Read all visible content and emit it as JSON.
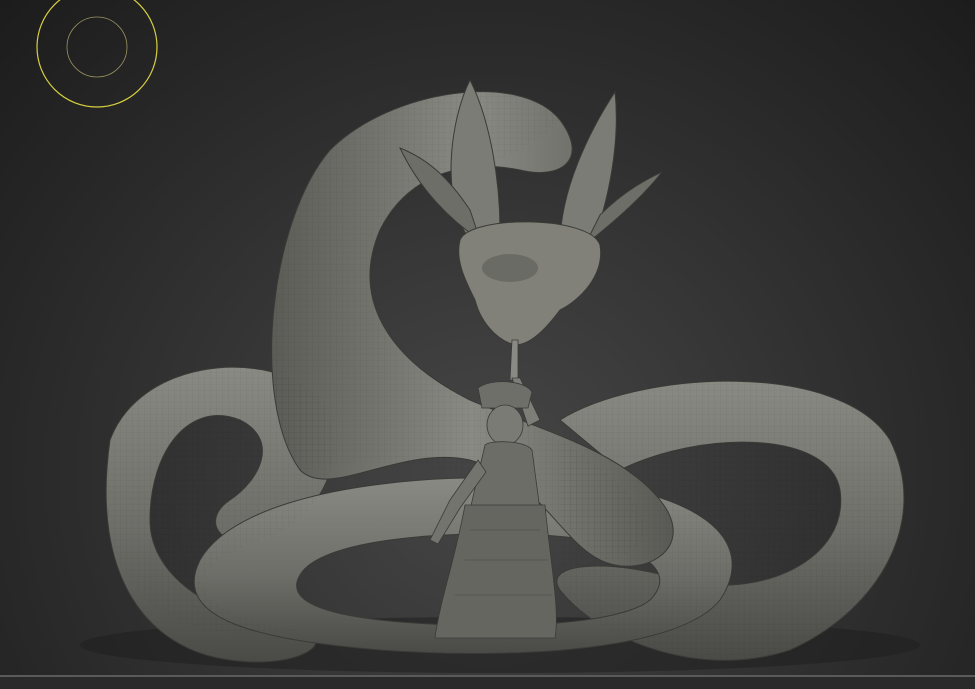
{
  "viewport": {
    "background_top": "#1c1c1c",
    "background_center": "#464646",
    "brush_cursor_color": "#d8d040",
    "model_color": "#7a7a74"
  },
  "icons": {
    "brush_cursor": "brush-cursor-icon"
  }
}
